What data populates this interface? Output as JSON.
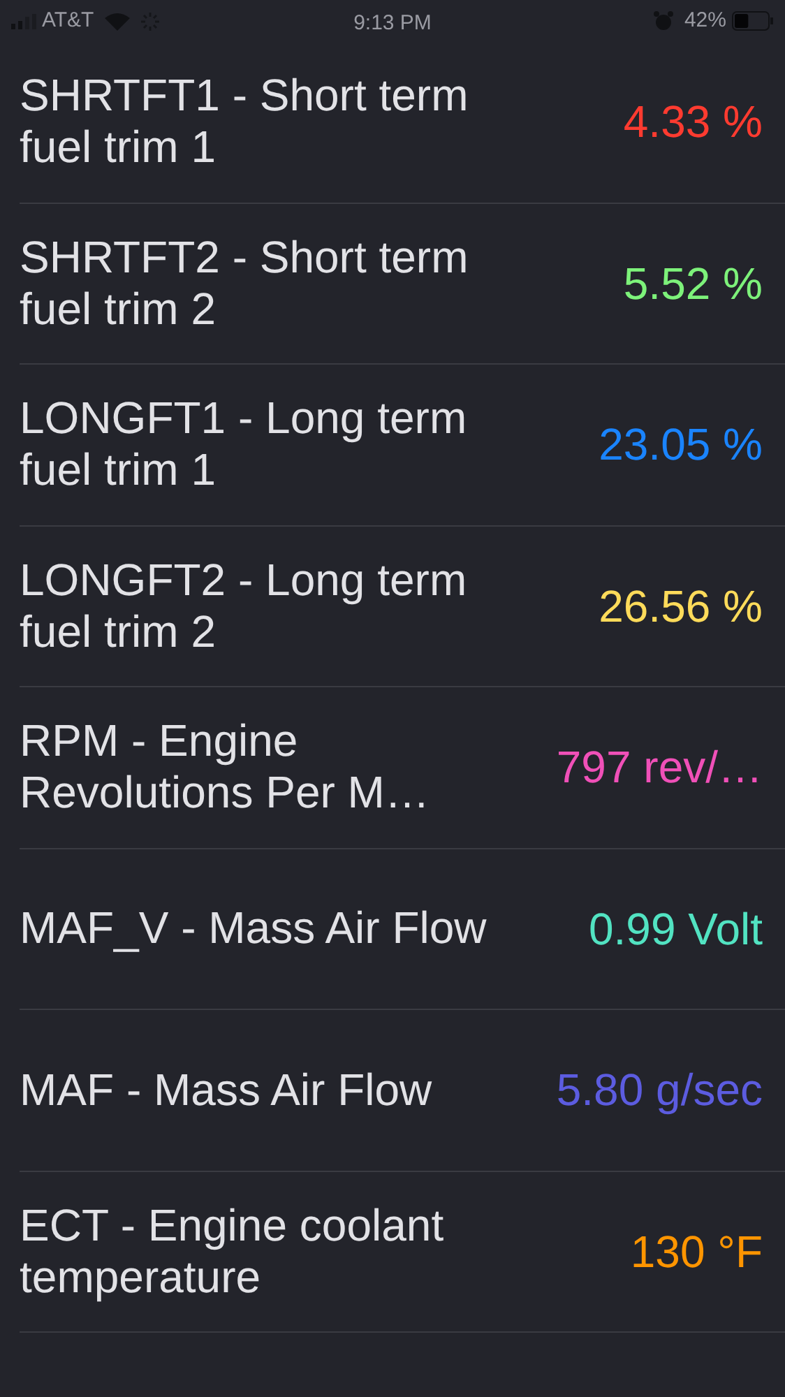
{
  "status_bar": {
    "carrier": "AT&T",
    "time": "9:13 PM",
    "battery": "42%"
  },
  "readings": [
    {
      "label": "SHRTFT1 - Short term fuel trim 1",
      "value": "4.33 %",
      "color": "#ff3b30"
    },
    {
      "label": "SHRTFT2 - Short term fuel trim 2",
      "value": "5.52 %",
      "color": "#7df27a"
    },
    {
      "label": "LONGFT1 - Long term fuel trim 1",
      "value": "23.05 %",
      "color": "#1a84ff"
    },
    {
      "label": "LONGFT2 - Long term fuel trim 2",
      "value": "26.56 %",
      "color": "#fedb5a"
    },
    {
      "label": "RPM - Engine Revolutions Per M…",
      "value": "797 rev/…",
      "color": "#f050b8"
    },
    {
      "label": "MAF_V - Mass Air Flow",
      "value": "0.99 Volt",
      "color": "#52e3c2"
    },
    {
      "label": "MAF - Mass Air Flow",
      "value": "5.80 g/sec",
      "color": "#5c5ce0"
    },
    {
      "label": "ECT - Engine coolant temperature",
      "value": "130 °F",
      "color": "#ff9500"
    }
  ]
}
